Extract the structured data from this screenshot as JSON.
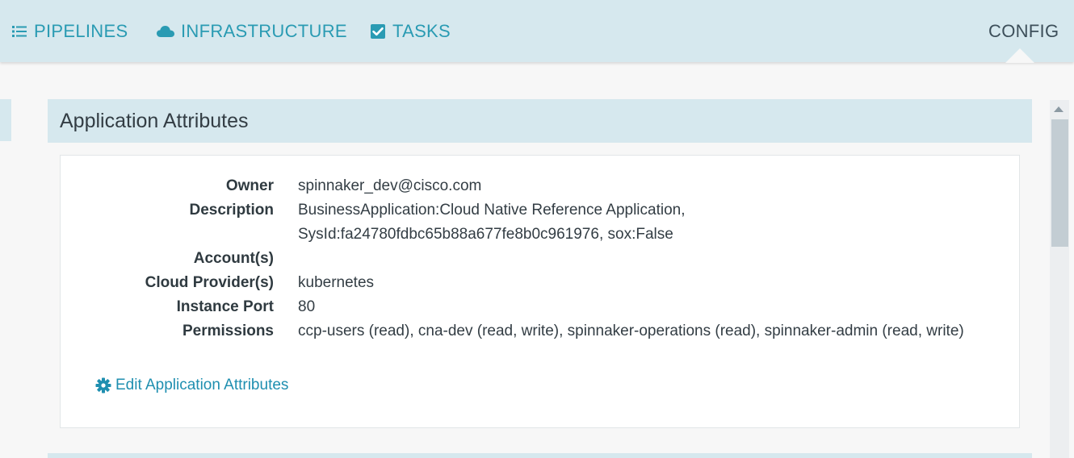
{
  "nav": {
    "pipelines": {
      "label": "PIPELINES",
      "icon": "list-icon"
    },
    "infrastructure": {
      "label": "INFRASTRUCTURE",
      "icon": "cloud-icon"
    },
    "tasks": {
      "label": "TASKS",
      "icon": "checkbox-icon"
    },
    "config": {
      "label": "CONFIG",
      "active": true
    }
  },
  "section": {
    "title": "Application Attributes"
  },
  "attributes": [
    {
      "label": "Owner",
      "value": "spinnaker_dev@cisco.com"
    },
    {
      "label": "Description",
      "value": "BusinessApplication:Cloud Native Reference Application,",
      "value2": "SysId:fa24780fdbc65b88a677fe8b0c961976, sox:False"
    },
    {
      "label": "Account(s)",
      "value": ""
    },
    {
      "label": "Cloud Provider(s)",
      "value": "kubernetes"
    },
    {
      "label": "Instance Port",
      "value": "80"
    },
    {
      "label": "Permissions",
      "value": "ccp-users (read), cna-dev (read, write), spinnaker-operations (read), spinnaker-admin (read, write)"
    }
  ],
  "edit_link": {
    "label": "Edit Application Attributes",
    "icon": "gear-icon"
  },
  "colors": {
    "nav_bg": "#d6e8ee",
    "accent": "#2a9bb3",
    "link": "#1f8fb0",
    "active_text": "#3d4f5a"
  }
}
